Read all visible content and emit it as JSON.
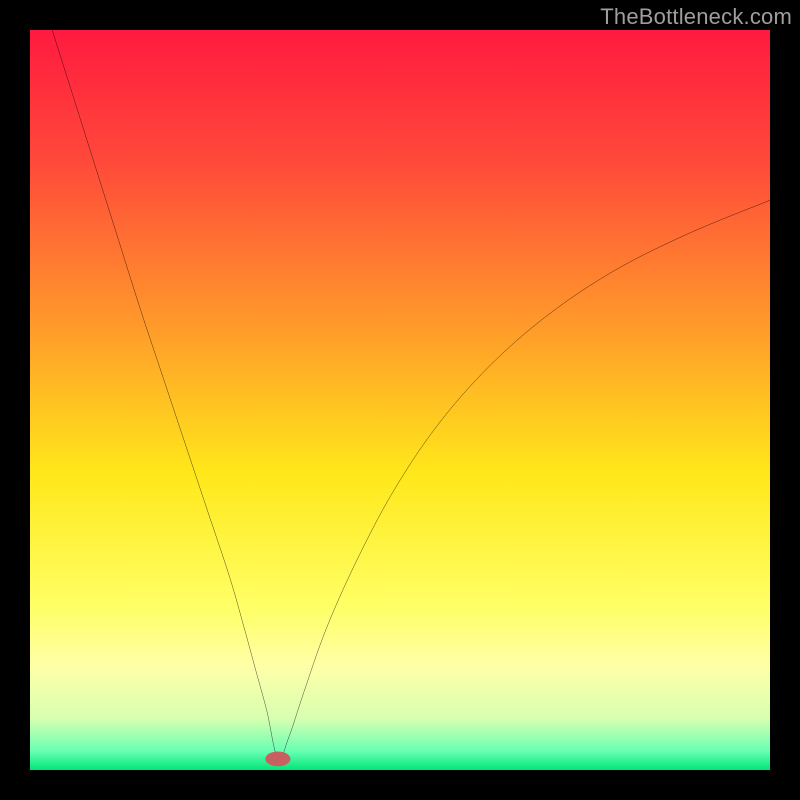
{
  "watermark": "TheBottleneck.com",
  "chart_data": {
    "type": "line",
    "title": "",
    "xlabel": "",
    "ylabel": "",
    "xlim": [
      0,
      100
    ],
    "ylim": [
      0,
      100
    ],
    "grid": false,
    "legend": false,
    "background_gradient_stops": [
      {
        "offset": 0.0,
        "color": "#ff1a3f"
      },
      {
        "offset": 0.18,
        "color": "#ff4a3a"
      },
      {
        "offset": 0.4,
        "color": "#ff9a2a"
      },
      {
        "offset": 0.6,
        "color": "#ffe81a"
      },
      {
        "offset": 0.78,
        "color": "#ffff66"
      },
      {
        "offset": 0.86,
        "color": "#ffffa8"
      },
      {
        "offset": 0.93,
        "color": "#d8ffb0"
      },
      {
        "offset": 0.975,
        "color": "#66ffb3"
      },
      {
        "offset": 1.0,
        "color": "#00e676"
      }
    ],
    "minimum_marker": {
      "x": 33.5,
      "y": 1.5,
      "rx": 1.7,
      "ry": 1.0,
      "color": "#c86060"
    },
    "series": [
      {
        "name": "bottleneck-curve",
        "color": "#000000",
        "x": [
          3.0,
          6.0,
          9.0,
          12.0,
          15.0,
          18.0,
          21.0,
          24.0,
          27.0,
          29.0,
          30.5,
          32.0,
          33.5,
          35.0,
          37.0,
          40.0,
          44.0,
          49.0,
          55.0,
          62.0,
          70.0,
          79.0,
          89.0,
          100.0
        ],
        "y": [
          100.0,
          90.5,
          81.0,
          71.5,
          62.0,
          53.0,
          44.0,
          35.0,
          26.0,
          19.0,
          13.5,
          8.0,
          1.5,
          4.5,
          10.5,
          19.0,
          28.0,
          37.5,
          46.5,
          54.5,
          61.5,
          67.5,
          72.5,
          77.0
        ]
      }
    ]
  }
}
